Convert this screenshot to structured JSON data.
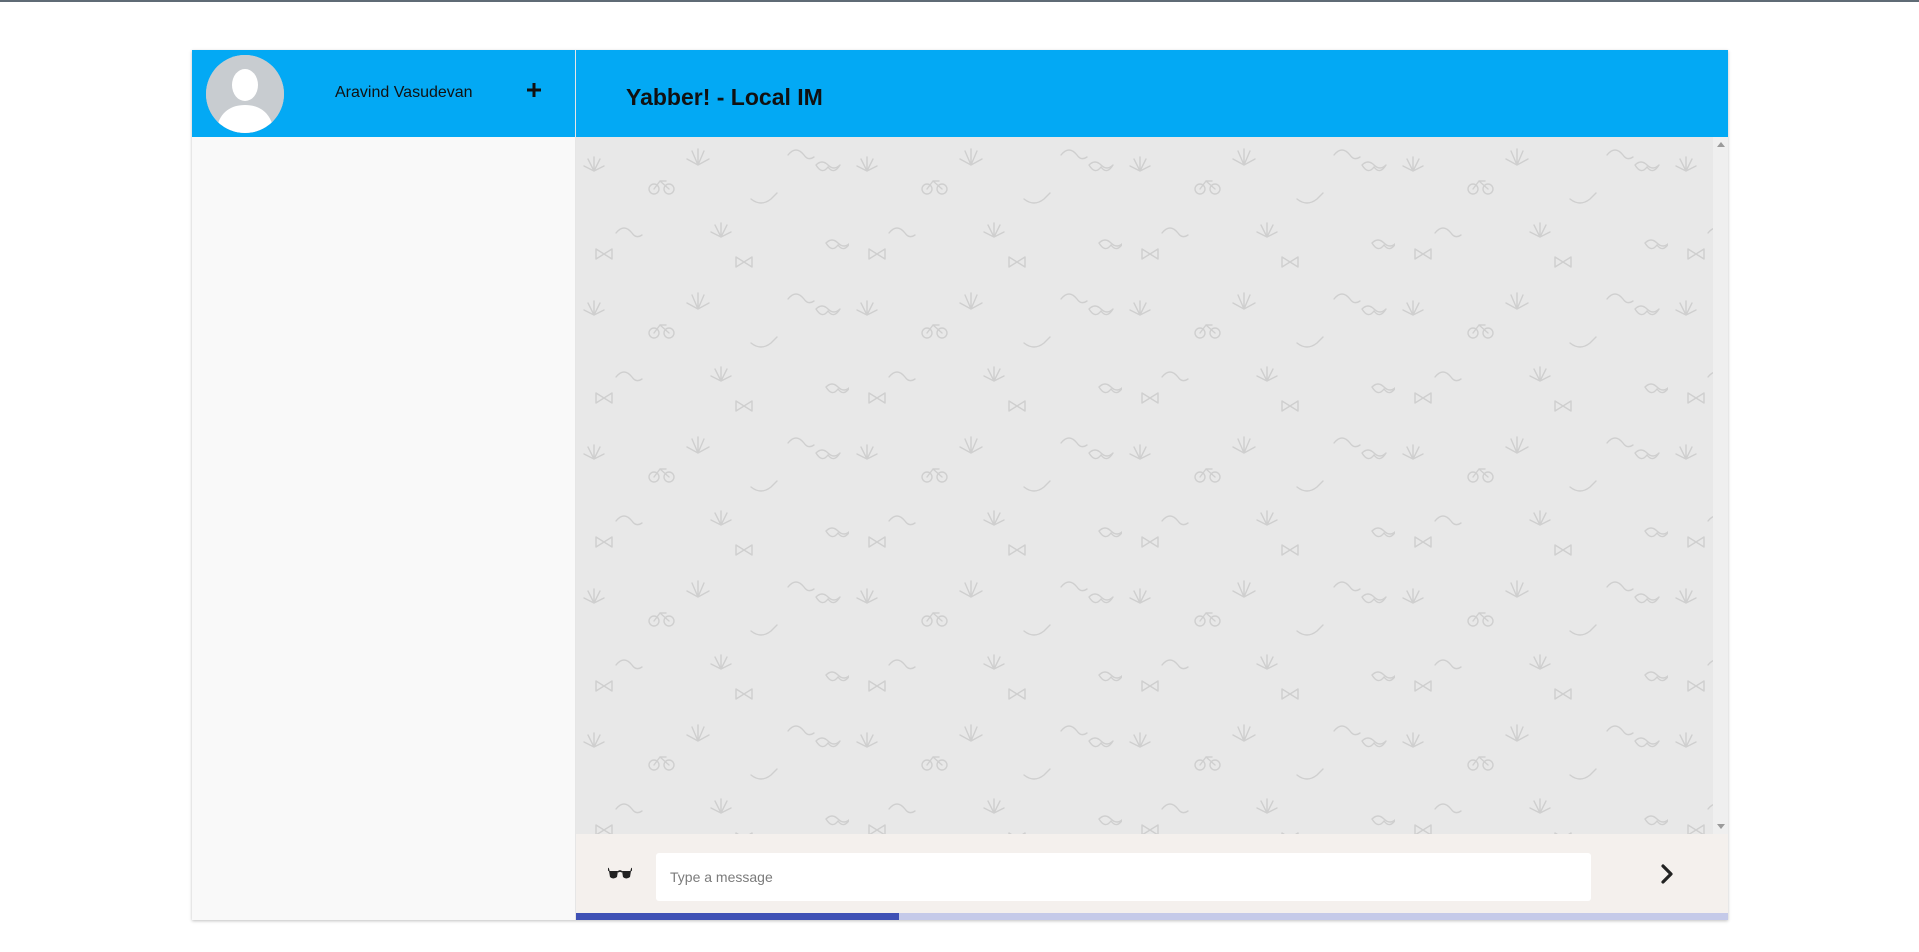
{
  "colors": {
    "header_bg": "#03a9f4",
    "sidebar_bg": "#f9f9f9",
    "chat_bg": "#e8e8e8",
    "composer_bg": "#f4f0ed",
    "progress_fill": "#3f51b5",
    "progress_track": "#c5cae9"
  },
  "sidebar": {
    "user_name": "Aravind Vasudevan",
    "avatar_icon": "default-user-avatar",
    "add_icon": "plus-icon"
  },
  "chat": {
    "title": "Yabber! - Local IM",
    "background_pattern": "doodle-pattern"
  },
  "composer": {
    "emoji_icon": "sunglasses-icon",
    "input_placeholder": "Type a message",
    "input_value": "",
    "send_icon": "chevron-right-icon"
  },
  "progress": {
    "fraction": 0.28
  }
}
